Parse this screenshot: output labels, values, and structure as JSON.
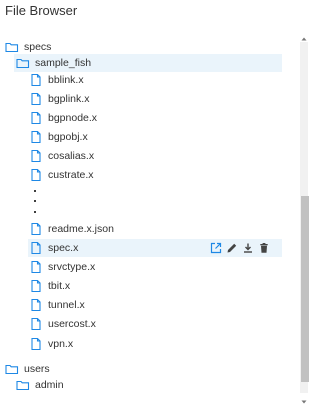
{
  "title": "File Browser",
  "colors": {
    "accent": "#1e88e5",
    "highlight": "#eaf4fb",
    "text": "#333333"
  },
  "tree": {
    "root_folders": [
      {
        "label": "specs",
        "icon": "folder-icon"
      },
      {
        "label": "users",
        "icon": "folder-icon"
      }
    ],
    "subfolders": [
      {
        "label": "sample_fish",
        "icon": "folder-icon"
      },
      {
        "label": "admin",
        "icon": "folder-icon"
      }
    ],
    "files_top": [
      {
        "label": "bblink.x"
      },
      {
        "label": "bgplink.x"
      },
      {
        "label": "bgpnode.x"
      },
      {
        "label": "bgpobj.x"
      },
      {
        "label": "cosalias.x"
      },
      {
        "label": "custrate.x"
      }
    ],
    "files_bottom": [
      {
        "label": "readme.x.json"
      },
      {
        "label": "spec.x"
      },
      {
        "label": "srvctype.x"
      },
      {
        "label": "tbit.x"
      },
      {
        "label": "tunnel.x"
      },
      {
        "label": "usercost.x"
      },
      {
        "label": "vpn.x"
      }
    ]
  },
  "row_actions": [
    "open-external-icon",
    "edit-pencil-icon",
    "download-icon",
    "trash-icon"
  ],
  "scroll": {
    "thumb_start": 0.44,
    "thumb_end": 0.97
  }
}
